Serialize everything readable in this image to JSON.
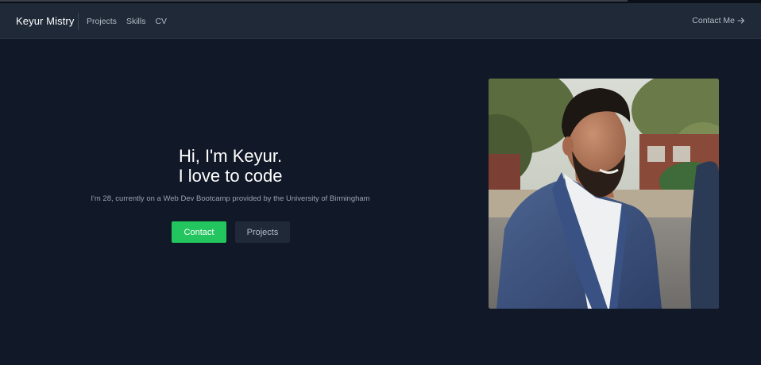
{
  "navbar": {
    "brand": "Keyur Mistry",
    "links": [
      "Projects",
      "Skills",
      "CV"
    ],
    "contact_label": "Contact Me",
    "contact_icon": "arrow-right-icon"
  },
  "hero": {
    "title_line1": "Hi, I'm Keyur.",
    "title_line2": "I love to code",
    "subtitle": "I'm 28, currently on a Web Dev Bootcamp provided by the University of Birmingham",
    "primary_button": "Contact",
    "secondary_button": "Projects"
  },
  "photo": {
    "alt": "Portrait of Keyur Mistry"
  },
  "colors": {
    "background": "#111827",
    "navbar": "#1f2937",
    "accent": "#22c55e",
    "muted_text": "#9aa3b0"
  }
}
